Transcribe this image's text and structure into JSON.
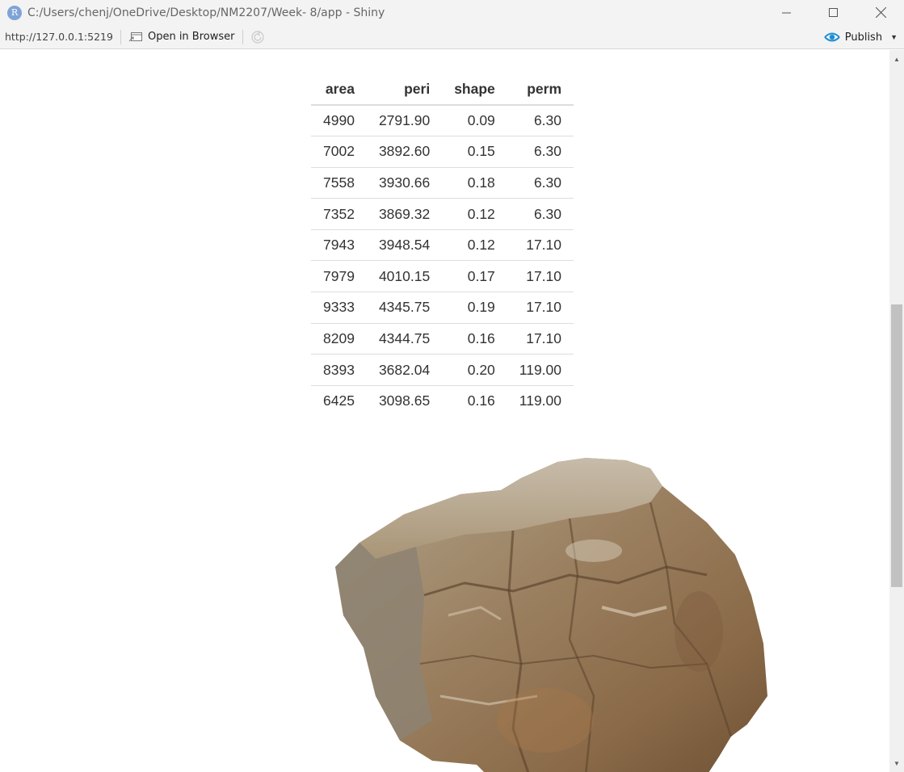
{
  "window": {
    "app_icon_letter": "R",
    "title": "C:/Users/chenj/OneDrive/Desktop/NM2207/Week- 8/app - Shiny"
  },
  "toolbar": {
    "url": "http://127.0.0.1:5219",
    "open_in_browser_label": "Open in Browser",
    "publish_label": "Publish"
  },
  "table": {
    "columns": [
      "area",
      "peri",
      "shape",
      "perm"
    ],
    "rows": [
      [
        "4990",
        "2791.90",
        "0.09",
        "6.30"
      ],
      [
        "7002",
        "3892.60",
        "0.15",
        "6.30"
      ],
      [
        "7558",
        "3930.66",
        "0.18",
        "6.30"
      ],
      [
        "7352",
        "3869.32",
        "0.12",
        "6.30"
      ],
      [
        "7943",
        "3948.54",
        "0.12",
        "17.10"
      ],
      [
        "7979",
        "4010.15",
        "0.17",
        "17.10"
      ],
      [
        "9333",
        "4345.75",
        "0.19",
        "17.10"
      ],
      [
        "8209",
        "4344.75",
        "0.16",
        "17.10"
      ],
      [
        "8393",
        "3682.04",
        "0.20",
        "119.00"
      ],
      [
        "6425",
        "3098.65",
        "0.16",
        "119.00"
      ]
    ]
  },
  "colors": {
    "publish_accent": "#1b8fd6",
    "titlebar_bg": "#f3f3f3"
  }
}
